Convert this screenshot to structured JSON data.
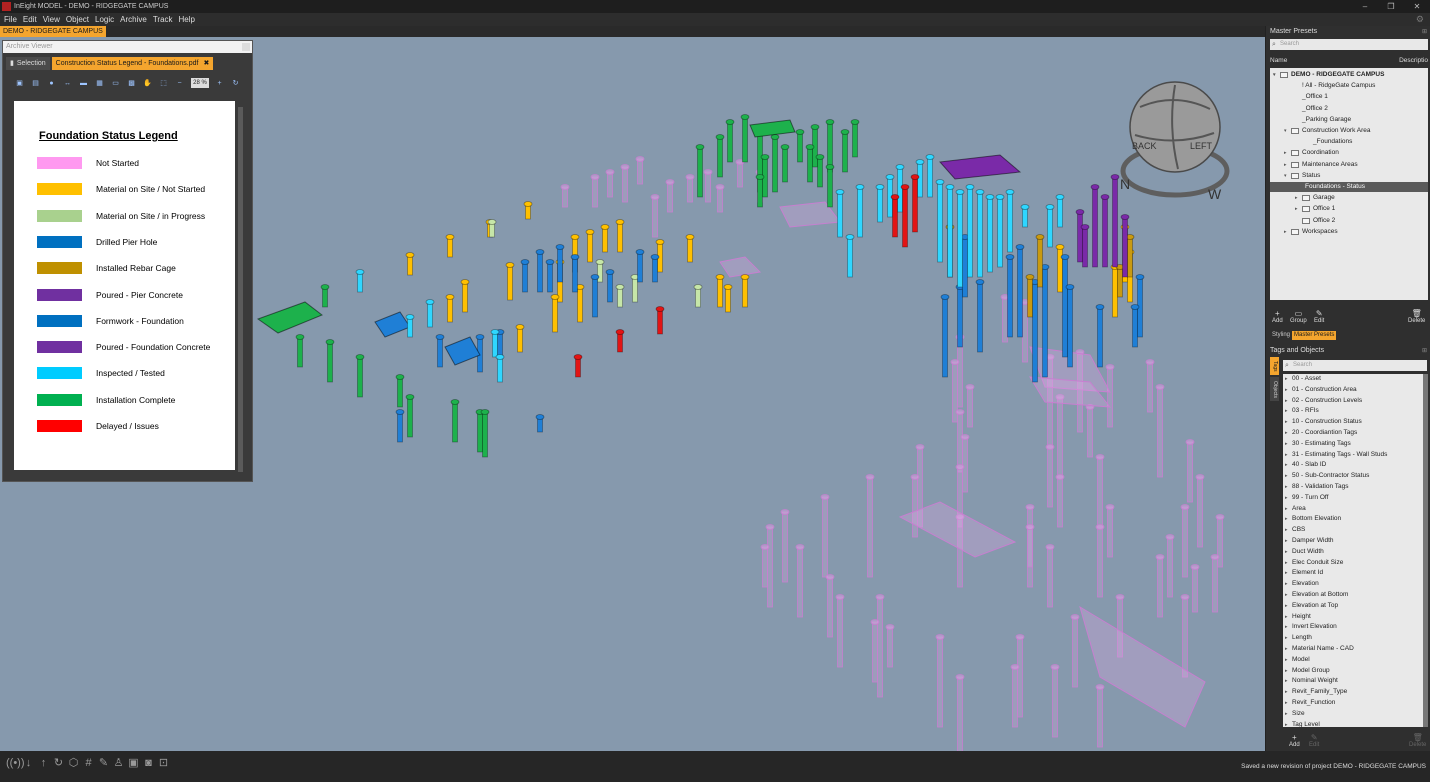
{
  "window": {
    "title": "InEight MODEL - DEMO - RIDGEGATE CAMPUS",
    "controls": [
      "–",
      "❐",
      "✕"
    ]
  },
  "menu": [
    "File",
    "Edit",
    "View",
    "Object",
    "Logic",
    "Archive",
    "Track",
    "Help"
  ],
  "project_tab": "DEMO - RIDGEGATE CAMPUS",
  "archive_viewer": {
    "title": "Archive Viewer",
    "tabs": [
      {
        "label": "Selection",
        "active": false
      },
      {
        "label": "Construction Status Legend - Foundations.pdf",
        "active": true
      }
    ],
    "zoom": "28 %",
    "legend_title": "Foundation Status Legend",
    "legend": [
      {
        "label": "Not Started",
        "color": "#ff99f0"
      },
      {
        "label": "Material on Site / Not Started",
        "color": "#ffc000"
      },
      {
        "label": "Material on Site / in Progress",
        "color": "#a9d18e"
      },
      {
        "label": "Drilled Pier Hole",
        "color": "#0070c0"
      },
      {
        "label": "Installed Rebar Cage",
        "color": "#bf9000"
      },
      {
        "label": "Poured - Pier Concrete",
        "color": "#7030a0"
      },
      {
        "label": "Formwork - Foundation",
        "color": "#0070c0"
      },
      {
        "label": "Poured - Foundation Concrete",
        "color": "#7030a0"
      },
      {
        "label": "Inspected / Tested",
        "color": "#00ccff"
      },
      {
        "label": "Installation Complete",
        "color": "#00b050"
      },
      {
        "label": "Delayed / Issues",
        "color": "#ff0000"
      }
    ]
  },
  "master_presets": {
    "title": "Master Presets",
    "search_placeholder": "Search",
    "columns": [
      "Name",
      "Descriptio"
    ],
    "tree": [
      {
        "label": "DEMO - RIDGEGATE CAMPUS",
        "level": 0,
        "arrow": "▾",
        "folder": true,
        "bold": true
      },
      {
        "label": "! All - RidgeGate Campus",
        "level": 1,
        "arrow": "",
        "folder": false
      },
      {
        "label": "_Office 1",
        "level": 1,
        "arrow": "",
        "folder": false
      },
      {
        "label": "_Office 2",
        "level": 1,
        "arrow": "",
        "folder": false
      },
      {
        "label": "_Parking Garage",
        "level": 1,
        "arrow": "",
        "folder": false
      },
      {
        "label": "Construction Work Area",
        "level": 1,
        "arrow": "▾",
        "folder": true
      },
      {
        "label": "_Foundations",
        "level": 2,
        "arrow": "",
        "folder": false
      },
      {
        "label": "Coordination",
        "level": 1,
        "arrow": "▸",
        "folder": true
      },
      {
        "label": "Maintenance Areas",
        "level": 1,
        "arrow": "▸",
        "folder": true
      },
      {
        "label": "Status",
        "level": 1,
        "arrow": "▾",
        "folder": true
      },
      {
        "label": "Foundations - Status",
        "level": 2,
        "arrow": "",
        "folder": false,
        "selected": true
      },
      {
        "label": "Garage",
        "level": 2,
        "arrow": "▸",
        "folder": true
      },
      {
        "label": "Office 1",
        "level": 2,
        "arrow": "▸",
        "folder": true
      },
      {
        "label": "Office 2",
        "level": 2,
        "arrow": "",
        "folder": true
      },
      {
        "label": "Workspaces",
        "level": 1,
        "arrow": "▸",
        "folder": true
      }
    ],
    "actions": [
      "Add",
      "Group",
      "Edit",
      "Delete"
    ],
    "bottom_tabs": [
      {
        "label": "Styling",
        "active": false
      },
      {
        "label": "Master Presets",
        "active": true
      }
    ]
  },
  "tags_panel": {
    "title": "Tags and Objects",
    "side_tabs": [
      "Tags",
      "Objects"
    ],
    "search_placeholder": "Search",
    "items": [
      "00 - Asset",
      "01 - Construction Area",
      "02 - Construction Levels",
      "03 - RFIs",
      "10 - Construction Status",
      "20 - Coordiantion Tags",
      "30 - Estimating Tags",
      "31 - Estimating Tags - Wall Studs",
      "40 - Slab ID",
      "50 - Sub-Contractor Status",
      "88 - Validation Tags",
      "99 - Turn Off",
      "Area",
      "Bottom Elevation",
      "CBS",
      "Damper Width",
      "Duct Width",
      "Elec Conduit Size",
      "Element Id",
      "Elevation",
      "Elevation at Bottom",
      "Elevation at Top",
      "Height",
      "Invert Elevation",
      "Length",
      "Material Name - CAD",
      "Model",
      "Model Group",
      "Nominal Weight",
      "Revit_Family_Type",
      "Revit_Function",
      "Size",
      "Tag Level"
    ],
    "actions": [
      "Add",
      "Edit",
      "Delete"
    ]
  },
  "viewcube": {
    "faces": [
      "BACK",
      "LEFT"
    ],
    "compass": [
      "N",
      "W"
    ]
  },
  "status": {
    "message": "Saved a new revision of project DEMO - RIDGEGATE CAMPUS"
  },
  "toolbar_icons": [
    "radio-icon",
    "arrow-down-icon",
    "arrow-up-icon",
    "refresh-icon",
    "cube-icon",
    "grid-icon",
    "measure-icon",
    "person-icon",
    "box-icon",
    "camera-icon",
    "screenshot-icon"
  ]
}
